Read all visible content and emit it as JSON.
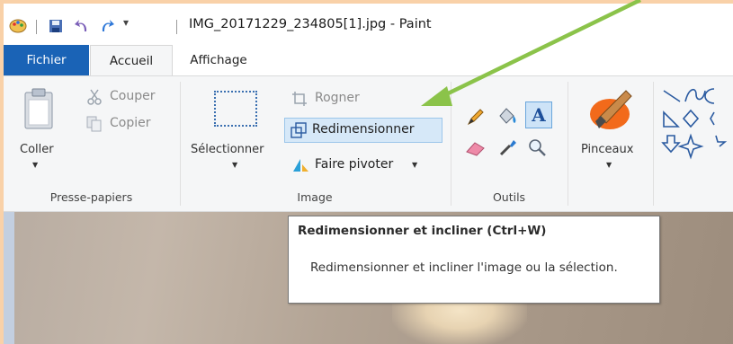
{
  "window": {
    "title": "IMG_20171229_234805[1].jpg - Paint"
  },
  "tabs": [
    {
      "label": "Fichier"
    },
    {
      "label": "Accueil"
    },
    {
      "label": "Affichage"
    }
  ],
  "ribbon": {
    "clipboard": {
      "paste_label": "Coller",
      "cut_label": "Couper",
      "copy_label": "Copier",
      "group_label": "Presse-papiers"
    },
    "image": {
      "select_label": "Sélectionner",
      "crop_label": "Rogner",
      "resize_label": "Redimensionner",
      "rotate_label": "Faire pivoter",
      "group_label": "Image"
    },
    "tools": {
      "group_label": "Outils"
    },
    "brushes": {
      "label": "Pinceaux"
    }
  },
  "tooltip": {
    "title": "Redimensionner et incliner (Ctrl+W)",
    "description": "Redimensionner et incliner l'image ou la sélection."
  },
  "colors": {
    "file_tab": "#1a63b6",
    "highlight": "#d6e8f8",
    "annotation_arrow": "#8bc34a",
    "frame": "#f9d1a8"
  }
}
